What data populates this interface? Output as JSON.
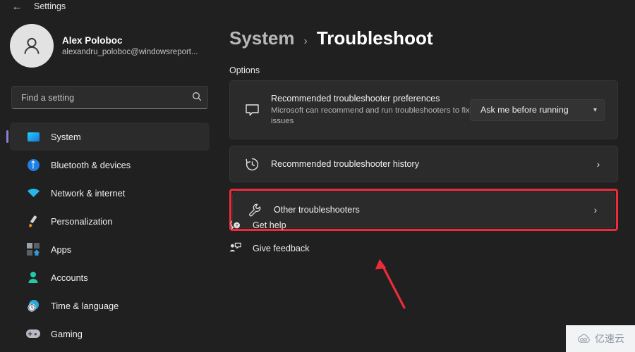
{
  "window": {
    "app_title": "Settings",
    "back_icon": "back-arrow-icon"
  },
  "colors": {
    "background": "#202020",
    "card": "#2b2b2b",
    "accent_selected": "#8a7fd4",
    "highlight_red": "#ee2b3a",
    "text_primary": "#ffffff",
    "text_secondary": "#b6b6b6"
  },
  "sidebar": {
    "profile": {
      "name": "Alex Poloboc",
      "email": "alexandru_poloboc@windowsreport...",
      "avatar_icon": "user-avatar-icon"
    },
    "search": {
      "placeholder": "Find a setting",
      "value": "",
      "icon": "search-icon"
    },
    "items": [
      {
        "label": "System",
        "icon": "monitor-icon",
        "selected": true
      },
      {
        "label": "Bluetooth & devices",
        "icon": "bluetooth-icon",
        "selected": false
      },
      {
        "label": "Network & internet",
        "icon": "wifi-icon",
        "selected": false
      },
      {
        "label": "Personalization",
        "icon": "paintbrush-icon",
        "selected": false
      },
      {
        "label": "Apps",
        "icon": "apps-grid-icon",
        "selected": false
      },
      {
        "label": "Accounts",
        "icon": "account-person-icon",
        "selected": false
      },
      {
        "label": "Time & language",
        "icon": "clock-globe-icon",
        "selected": false
      },
      {
        "label": "Gaming",
        "icon": "gamepad-icon",
        "selected": false
      }
    ]
  },
  "main": {
    "breadcrumb": {
      "parent": "System",
      "separator": "›",
      "current": "Troubleshoot"
    },
    "section_label": "Options",
    "cards": [
      {
        "title": "Recommended troubleshooter preferences",
        "description": "Microsoft can recommend and run troubleshooters to fix issues",
        "icon": "message-bubble-icon",
        "control": "dropdown",
        "dropdown_value": "Ask me before running",
        "highlighted": false
      },
      {
        "title": "Recommended troubleshooter history",
        "description": "",
        "icon": "history-clock-icon",
        "control": "chevron",
        "chevron": "›",
        "highlighted": false
      },
      {
        "title": "Other troubleshooters",
        "description": "",
        "icon": "wrench-icon",
        "control": "chevron",
        "chevron": "›",
        "highlighted": true
      }
    ],
    "links": [
      {
        "label": "Get help",
        "icon": "help-question-icon"
      },
      {
        "label": "Give feedback",
        "icon": "feedback-icon"
      }
    ]
  },
  "annotation": {
    "arrow_color": "#ee2b3a",
    "arrow_name": "red-pointer-arrow"
  },
  "watermark": {
    "text": "亿速云",
    "logo_icon": "cloud-logo-icon"
  }
}
